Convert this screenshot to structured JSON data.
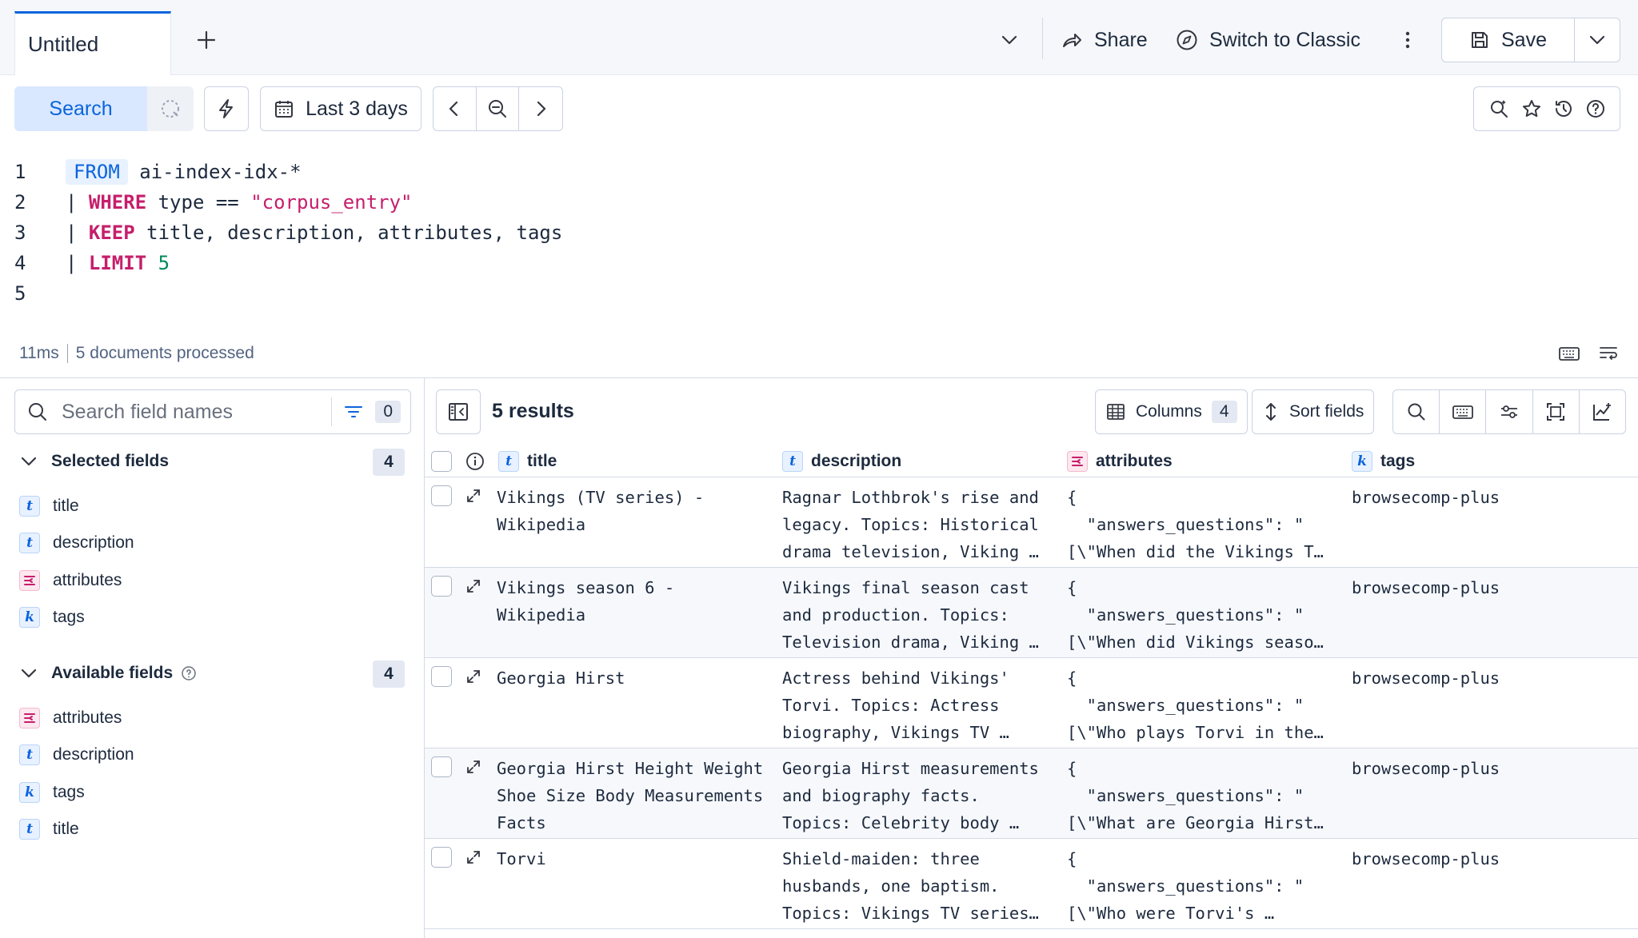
{
  "tabs": {
    "active_label": "Untitled"
  },
  "toolbar": {
    "share_label": "Share",
    "classic_label": "Switch to Classic",
    "save_label": "Save"
  },
  "query_bar": {
    "search_label": "Search",
    "date_label": "Last 3 days"
  },
  "editor": {
    "lines": [
      {
        "num": "1",
        "kw_from": "FROM",
        "rest": " ai-index-idx-*"
      },
      {
        "num": "2",
        "pipe": "| ",
        "kw": "WHERE",
        "rest": " type == ",
        "str": "\"corpus_entry\""
      },
      {
        "num": "3",
        "pipe": "| ",
        "kw": "KEEP",
        "rest": " title, description, attributes, tags"
      },
      {
        "num": "4",
        "pipe": "| ",
        "kw": "LIMIT",
        "num_val": " 5"
      },
      {
        "num": "5"
      }
    ]
  },
  "status": {
    "time": "11ms",
    "processed": "5 documents processed"
  },
  "sidebar": {
    "search_placeholder": "Search field names",
    "filter_count": "0",
    "selected": {
      "title": "Selected fields",
      "count": "4",
      "items": [
        {
          "type": "t",
          "name": "title"
        },
        {
          "type": "t",
          "name": "description"
        },
        {
          "type": "obj",
          "name": "attributes"
        },
        {
          "type": "k",
          "name": "tags"
        }
      ]
    },
    "available": {
      "title": "Available fields",
      "count": "4",
      "items": [
        {
          "type": "obj",
          "name": "attributes"
        },
        {
          "type": "t",
          "name": "description"
        },
        {
          "type": "k",
          "name": "tags"
        },
        {
          "type": "t",
          "name": "title"
        }
      ]
    }
  },
  "grid": {
    "results_label": "5 results",
    "columns_label": "Columns",
    "columns_count": "4",
    "sort_label": "Sort fields",
    "headers": {
      "title": "title",
      "description": "description",
      "attributes": "attributes",
      "tags": "tags"
    },
    "rows": [
      {
        "title": "Vikings (TV series) -\nWikipedia",
        "description": "Ragnar Lothbrok's rise and\nlegacy. Topics: Historical\ndrama television, Viking …",
        "attributes": "{\n  \"answers_questions\": \"\n[\\\"When did the Vikings T…",
        "tags": "browsecomp-plus"
      },
      {
        "title": "Vikings season 6 -\nWikipedia",
        "description": "Vikings final season cast\nand production. Topics:\nTelevision drama, Viking …",
        "attributes": "{\n  \"answers_questions\": \"\n[\\\"When did Vikings seaso…",
        "tags": "browsecomp-plus"
      },
      {
        "title": "Georgia Hirst",
        "description": "Actress behind Vikings'\nTorvi. Topics: Actress\nbiography, Vikings TV …",
        "attributes": "{\n  \"answers_questions\": \"\n[\\\"Who plays Torvi in the…",
        "tags": "browsecomp-plus"
      },
      {
        "title": "Georgia Hirst Height Weight\nShoe Size Body Measurements\nFacts",
        "description": "Georgia Hirst measurements\nand biography facts.\nTopics: Celebrity body …",
        "attributes": "{\n  \"answers_questions\": \"\n[\\\"What are Georgia Hirst…",
        "tags": "browsecomp-plus"
      },
      {
        "title": "Torvi",
        "description": "Shield-maiden: three\nhusbands, one baptism.\nTopics: Vikings TV series…",
        "attributes": "{\n  \"answers_questions\": \"\n[\\\"Who were Torvi's …",
        "tags": "browsecomp-plus"
      }
    ]
  }
}
